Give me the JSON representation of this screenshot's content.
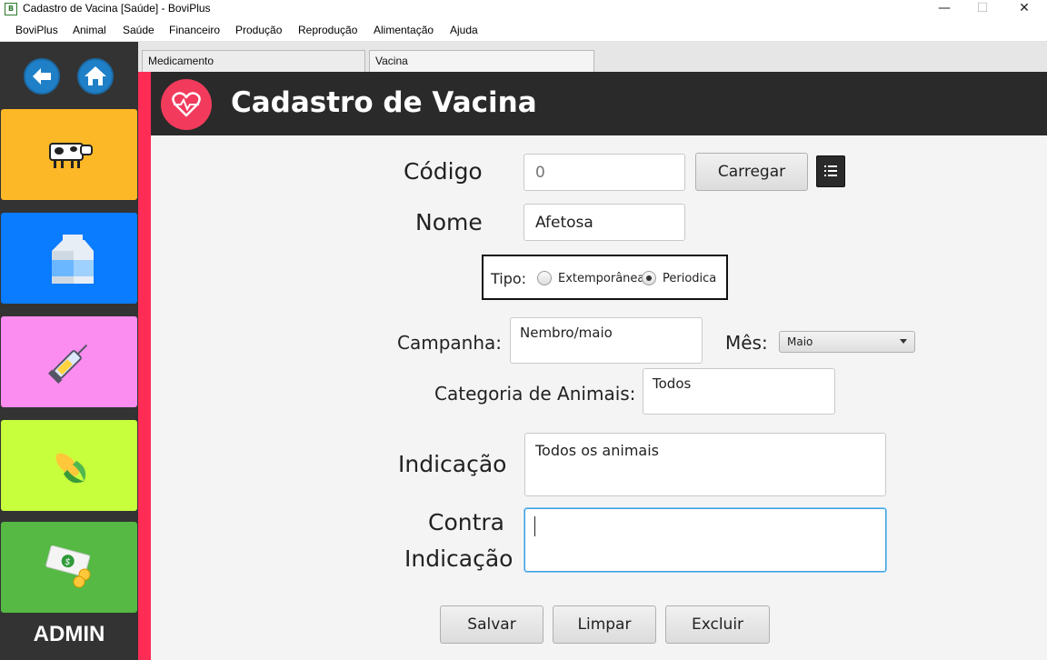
{
  "window": {
    "title": "Cadastro de Vacina [Saúde] - BoviPlus",
    "app_icon": "bp-logo-icon",
    "controls": {
      "minimize": "—",
      "maximize": "☐",
      "close": "✕"
    }
  },
  "menubar": {
    "items": [
      "BoviPlus",
      "Animal",
      "Saúde",
      "Financeiro",
      "Produção",
      "Reprodução",
      "Alimentação",
      "Ajuda"
    ]
  },
  "sidebar": {
    "back_icon": "arrow-left-icon",
    "home_icon": "home-icon",
    "tiles": [
      {
        "name": "animal",
        "icon": "cow-icon",
        "color": "#fdb827"
      },
      {
        "name": "producao",
        "icon": "milk-carton-icon",
        "color": "#0a7cff"
      },
      {
        "name": "saude",
        "icon": "syringe-icon",
        "color": "#fb8cf0"
      },
      {
        "name": "alimentacao",
        "icon": "corn-icon",
        "color": "#c8ff3c"
      },
      {
        "name": "financeiro",
        "icon": "money-icon",
        "color": "#55b944"
      }
    ],
    "user_label": "ADMIN",
    "accent_color": "#ff2d55"
  },
  "tabs": [
    {
      "label": "Medicamento",
      "active": false
    },
    {
      "label": "Vacina",
      "active": true
    }
  ],
  "header": {
    "title": "Cadastro de Vacina",
    "icon": "heart-pulse-icon"
  },
  "form": {
    "codigo": {
      "label": "Código",
      "placeholder": "0",
      "value": ""
    },
    "carregar_label": "Carregar",
    "list_icon": "list-icon",
    "nome": {
      "label": "Nome",
      "value": "Afetosa"
    },
    "tipo": {
      "label": "Tipo:",
      "options": [
        "Extemporânea",
        "Periodica"
      ],
      "selected": "Periodica"
    },
    "campanha": {
      "label": "Campanha:",
      "value": "Nembro/maio"
    },
    "mes": {
      "label": "Mês:",
      "selected": "Maio"
    },
    "categoria": {
      "label": "Categoria de Animais:",
      "value": "Todos"
    },
    "indicacao": {
      "label": "Indicação",
      "value": "Todos os animais"
    },
    "contra_indicacao": {
      "label_line1": "Contra",
      "label_line2": "Indicação",
      "value": ""
    },
    "buttons": {
      "salvar": "Salvar",
      "limpar": "Limpar",
      "excluir": "Excluir"
    }
  }
}
